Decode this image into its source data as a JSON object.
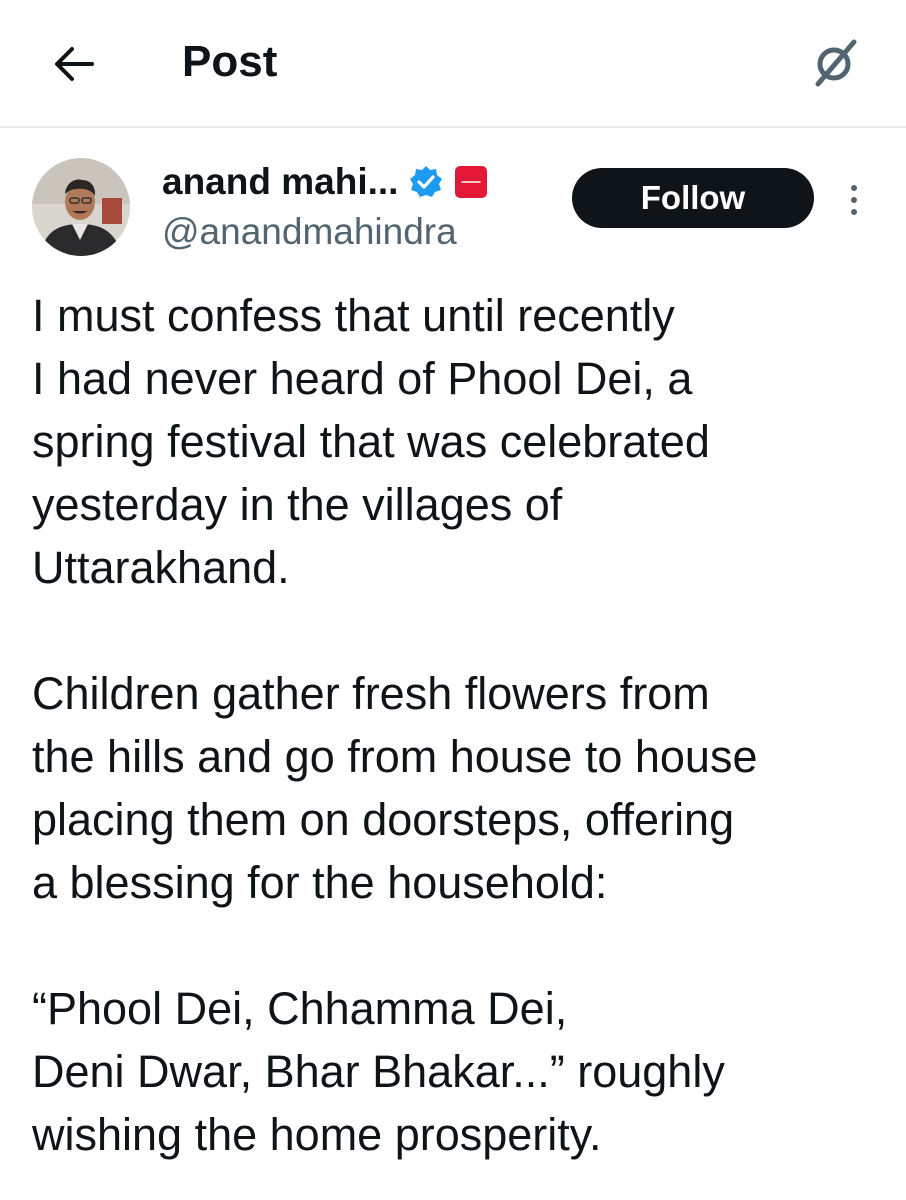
{
  "header": {
    "title": "Post",
    "back_icon": "arrow-left-icon",
    "grok_icon": "grok-icon"
  },
  "author": {
    "name": "anand mahi...",
    "handle": "@anandmahindra",
    "verified_icon": "verified-badge-icon",
    "affiliation_icon": "mahindra-affiliation-icon",
    "verified_color": "#1d9bf0",
    "affiliation_color": "#e31837"
  },
  "follow": {
    "label": "Follow",
    "bg_color": "#0f1419"
  },
  "tweet": {
    "paragraphs": [
      "I must confess that until recently\nI had never heard of Phool Dei, a\nspring festival that was celebrated\nyesterday in the villages of\nUttarakhand.",
      "Children gather fresh flowers from\nthe hills and go from house to house\nplacing them on doorsteps, offering\na blessing for the household:",
      "“Phool Dei, Chhamma Dei,\nDeni Dwar, Bhar Bhakar...” roughly\nwishing the home prosperity."
    ]
  }
}
